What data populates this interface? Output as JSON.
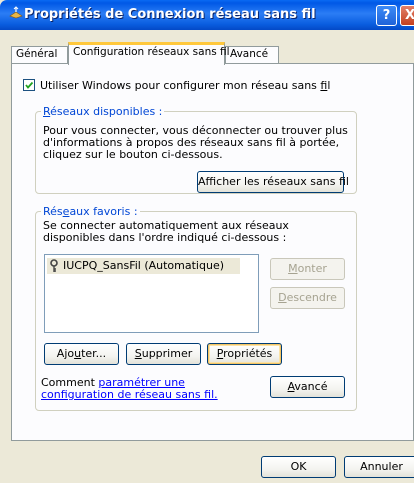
{
  "window": {
    "title": "Propriétés de Connexion réseau sans fil",
    "help_btn": "?",
    "close_btn": "X"
  },
  "tabs": [
    {
      "label": "Général",
      "active": false
    },
    {
      "label": "Configuration réseaux sans fil",
      "active": true
    },
    {
      "label": "Avancé",
      "active": false
    }
  ],
  "use_windows": {
    "checked": true,
    "label_prefix": "Utiliser Windows pour configurer mon réseau sans ",
    "label_accel": "f",
    "label_suffix": "il"
  },
  "available": {
    "legend_accel": "R",
    "legend_rest": "éseaux disponibles :",
    "description": "Pour vous connecter, vous déconnecter ou trouver plus d'informations à propos des réseaux sans fil à portée, cliquez sur le bouton ci-dessous.",
    "show_button": "Afficher les réseaux sans fil"
  },
  "preferred": {
    "legend_prefix": "Rés",
    "legend_accel": "e",
    "legend_suffix": "aux favoris :",
    "description": "Se connecter automatiquement aux réseaux disponibles dans l'ordre indiqué ci-dessous :",
    "networks": [
      {
        "name": "IUCPQ_SansFil (Automatique)",
        "icon": "key-icon"
      }
    ],
    "move_up": {
      "accel": "M",
      "rest": "onter"
    },
    "move_down": {
      "accel": "D",
      "rest": "escendre"
    },
    "add": {
      "prefix": "Ajo",
      "accel": "u",
      "suffix": "ter..."
    },
    "remove": {
      "accel": "S",
      "rest": "upprimer"
    },
    "properties": {
      "accel": "P",
      "rest": "ropriétés"
    }
  },
  "learn": {
    "prefix": "Comment ",
    "link": "paramétrer une configuration de réseau sans fil.",
    "advanced": {
      "accel": "A",
      "rest": "vancé"
    }
  },
  "footer": {
    "ok": "OK",
    "cancel": "Annuler"
  },
  "colors": {
    "titlebar": "#0a5ee0",
    "face": "#ece9d8",
    "link": "#0000ff",
    "legend": "#0046d5"
  }
}
